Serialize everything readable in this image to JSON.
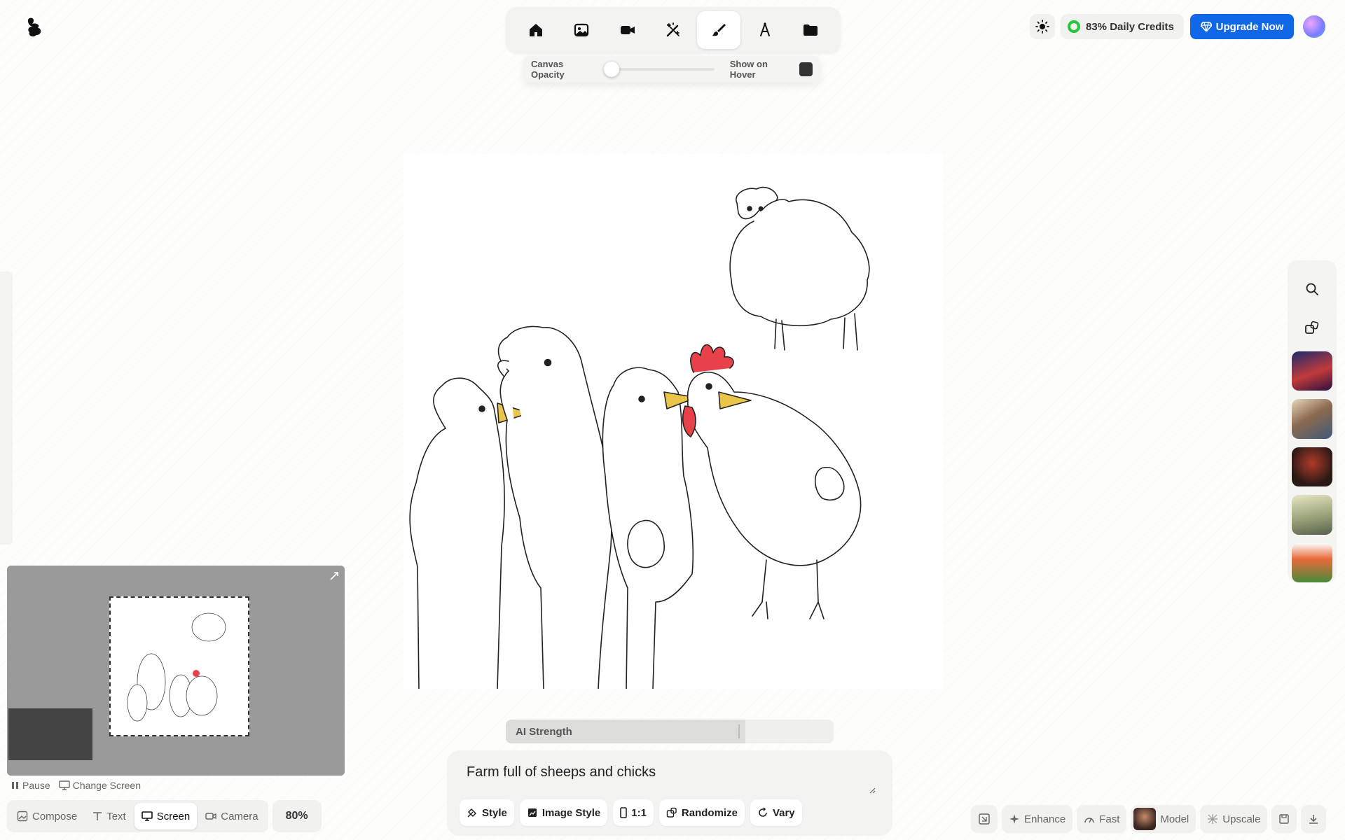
{
  "header": {
    "credits_label": "83% Daily Credits",
    "upgrade_label": "Upgrade Now"
  },
  "toolbar": {
    "tools": [
      "home-icon",
      "image-icon",
      "video-icon",
      "magic-wand-icon",
      "brush-icon",
      "text-tool-icon",
      "folder-icon"
    ],
    "active_tool": "brush-icon"
  },
  "opacity_panel": {
    "canvas_opacity_label": "Canvas Opacity",
    "canvas_opacity_value": 0,
    "show_on_hover_label": "Show on Hover"
  },
  "preview": {
    "pause_label": "Pause",
    "change_screen_label": "Change Screen"
  },
  "mode_bar": {
    "compose": "Compose",
    "text": "Text",
    "screen": "Screen",
    "camera": "Camera",
    "active": "Screen",
    "zoom": "80%"
  },
  "ai_strength": {
    "label": "AI Strength",
    "value": 0.73
  },
  "prompt": {
    "text": "Farm full of sheeps and chicks",
    "style": "Style",
    "image_style": "Image Style",
    "ratio": "1:1",
    "randomize": "Randomize",
    "vary": "Vary"
  },
  "bottom_right": {
    "enhance": "Enhance",
    "fast": "Fast",
    "model": "Model",
    "upscale": "Upscale"
  },
  "colors": {
    "accent": "#1068e8",
    "credit_ring": "#27c43d",
    "rooster_comb": "#e8414a",
    "beak": "#e9c54a"
  }
}
